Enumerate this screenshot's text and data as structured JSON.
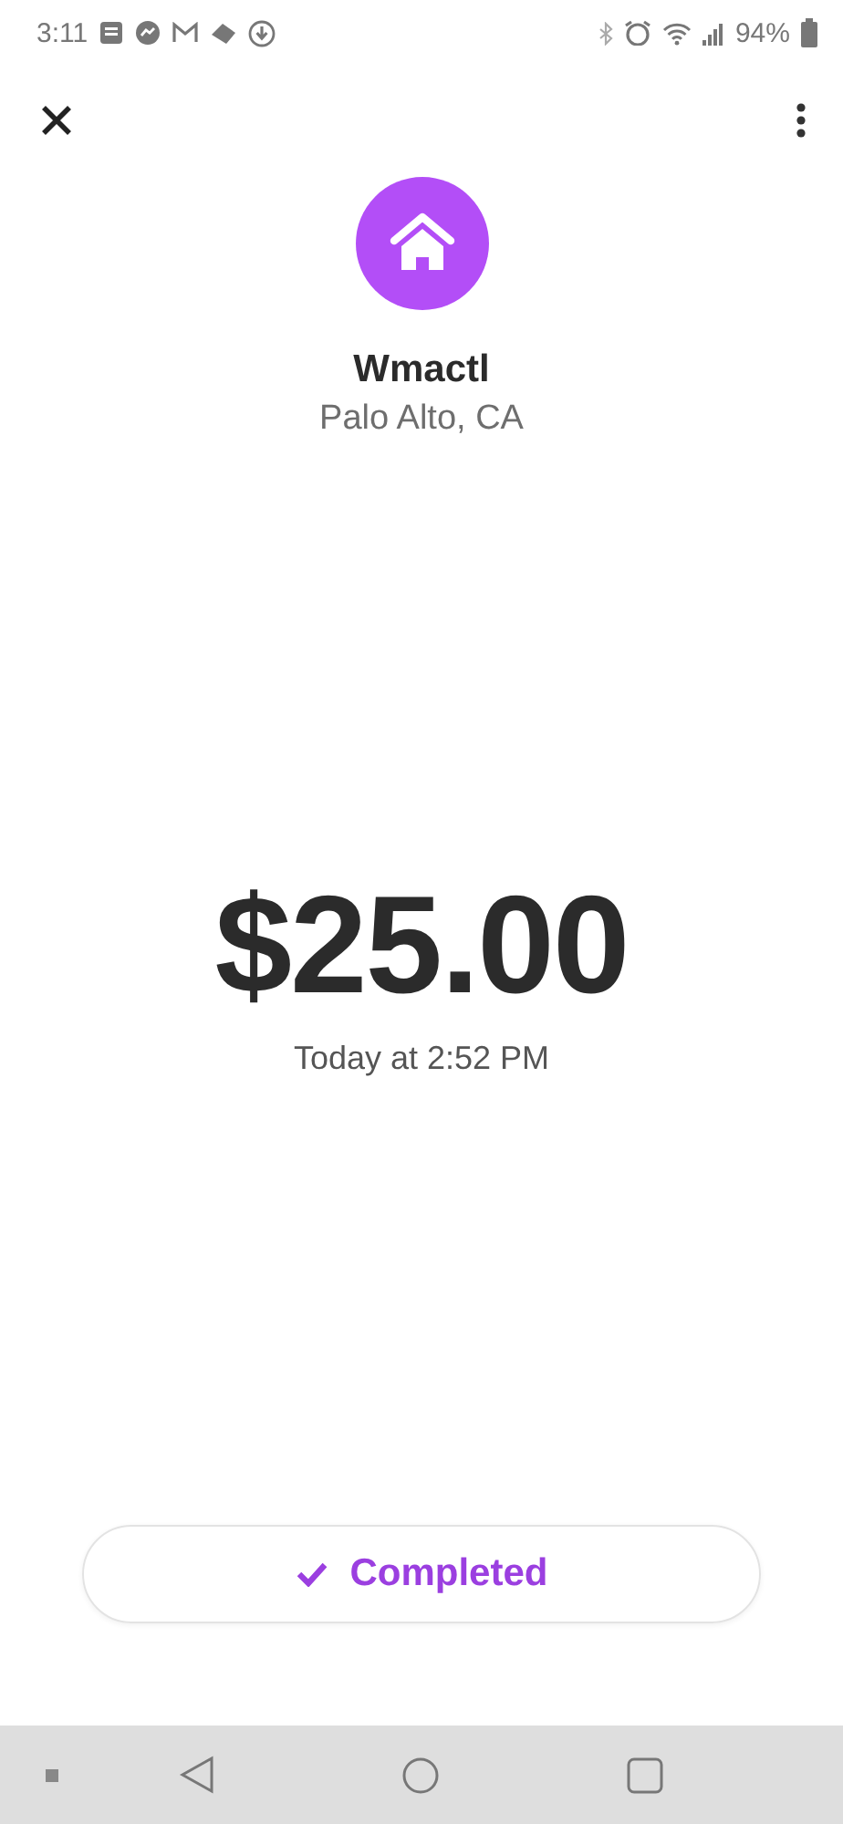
{
  "status_bar": {
    "time": "3:11",
    "battery": "94%"
  },
  "merchant": {
    "name": "Wmactl",
    "location": "Palo Alto, CA"
  },
  "payment": {
    "amount": "$25.00",
    "timestamp": "Today at 2:52 PM"
  },
  "status_button": {
    "label": "Completed"
  }
}
